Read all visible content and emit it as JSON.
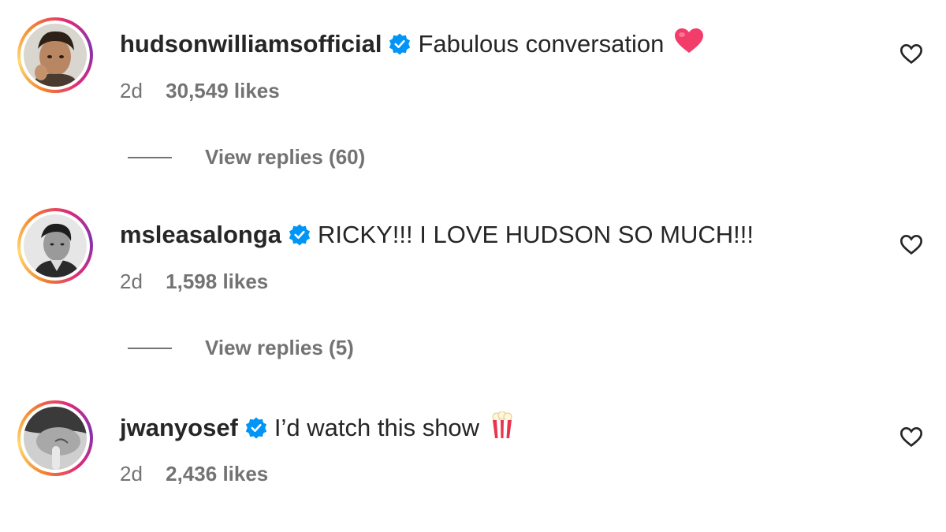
{
  "comments": [
    {
      "username": "hudsonwilliamsofficial",
      "verified": true,
      "text": "Fabulous conversation",
      "emoji": "heart-emoji",
      "time": "2d",
      "likes": "30,549 likes",
      "replies_label": "View replies (60)"
    },
    {
      "username": "msleasalonga",
      "verified": true,
      "text": "RICKY!!! I LOVE HUDSON SO MUCH!!!",
      "emoji": "",
      "time": "2d",
      "likes": "1,598 likes",
      "replies_label": "View replies (5)"
    },
    {
      "username": "jwanyosef",
      "verified": true,
      "text": "I’d watch this show",
      "emoji": "popcorn-emoji",
      "time": "2d",
      "likes": "2,436 likes",
      "replies_label": ""
    }
  ],
  "colors": {
    "text": "#262626",
    "secondary": "#737373",
    "verified_blue": "#0095f6",
    "heart_pink": "#f23d6b"
  },
  "icons": {
    "like": "heart-outline-icon",
    "verified": "verified-badge-icon"
  }
}
